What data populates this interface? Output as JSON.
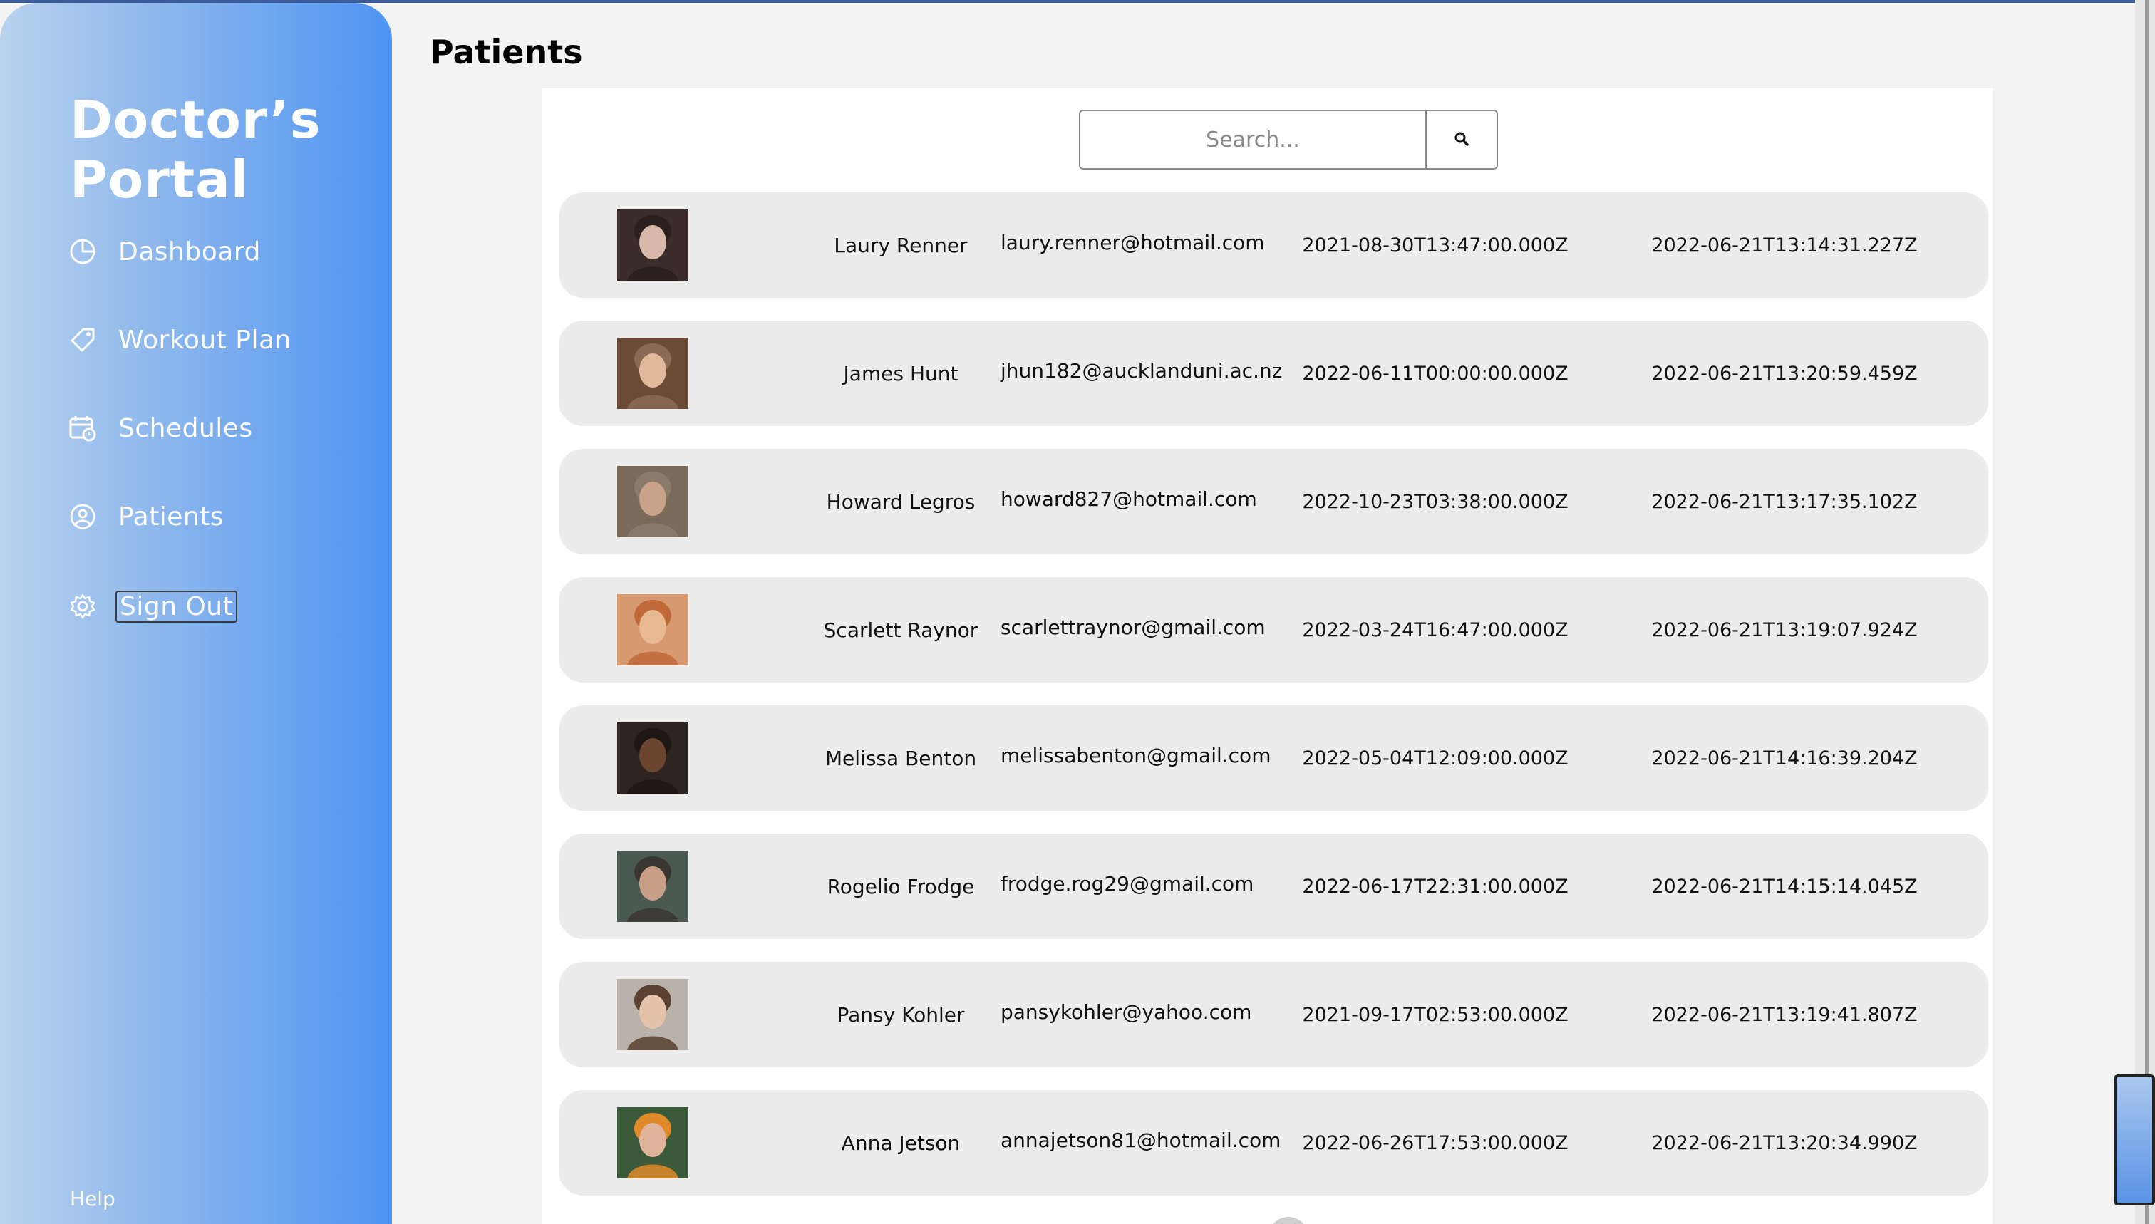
{
  "sidebar": {
    "brand": "Doctor’s Portal",
    "items": [
      {
        "label": "Dashboard",
        "icon": "pie-chart-icon"
      },
      {
        "label": "Workout Plan",
        "icon": "tag-icon"
      },
      {
        "label": "Schedules",
        "icon": "calendar-clock-icon"
      },
      {
        "label": "Patients",
        "icon": "user-circle-icon"
      },
      {
        "label": "Sign Out",
        "icon": "gear-icon"
      }
    ],
    "help": "Help"
  },
  "main": {
    "title": "Patients",
    "search": {
      "placeholder": "Search...",
      "value": "",
      "button_icon": "search-icon"
    }
  },
  "patients": [
    {
      "name": "Laury Renner",
      "email": "laury.renner@hotmail.com",
      "date1": "2021-08-30T13:47:00.000Z",
      "date2": "2022-06-21T13:14:31.227Z",
      "avatar": "avatar-photo"
    },
    {
      "name": "James Hunt",
      "email": "jhun182@aucklanduni.ac.nz",
      "date1": "2022-06-11T00:00:00.000Z",
      "date2": "2022-06-21T13:20:59.459Z",
      "avatar": "avatar-photo"
    },
    {
      "name": "Howard Legros",
      "email": "howard827@hotmail.com",
      "date1": "2022-10-23T03:38:00.000Z",
      "date2": "2022-06-21T13:17:35.102Z",
      "avatar": "avatar-photo"
    },
    {
      "name": "Scarlett Raynor",
      "email": "scarlettraynor@gmail.com",
      "date1": "2022-03-24T16:47:00.000Z",
      "date2": "2022-06-21T13:19:07.924Z",
      "avatar": "avatar-photo"
    },
    {
      "name": "Melissa Benton",
      "email": "melissabenton@gmail.com",
      "date1": "2022-05-04T12:09:00.000Z",
      "date2": "2022-06-21T14:16:39.204Z",
      "avatar": "avatar-photo"
    },
    {
      "name": "Rogelio Frodge",
      "email": "frodge.rog29@gmail.com",
      "date1": "2022-06-17T22:31:00.000Z",
      "date2": "2022-06-21T14:15:14.045Z",
      "avatar": "avatar-photo"
    },
    {
      "name": "Pansy Kohler",
      "email": "pansykohler@yahoo.com",
      "date1": "2021-09-17T02:53:00.000Z",
      "date2": "2022-06-21T13:19:41.807Z",
      "avatar": "avatar-photo"
    },
    {
      "name": "Anna Jetson",
      "email": "annajetson81@hotmail.com",
      "date1": "2022-06-26T17:53:00.000Z",
      "date2": "2022-06-21T13:20:34.990Z",
      "avatar": "avatar-photo"
    }
  ],
  "colors": {
    "accent": "#4e94f2",
    "row_bg": "#ececec",
    "page_bg": "#f3f3f3"
  }
}
